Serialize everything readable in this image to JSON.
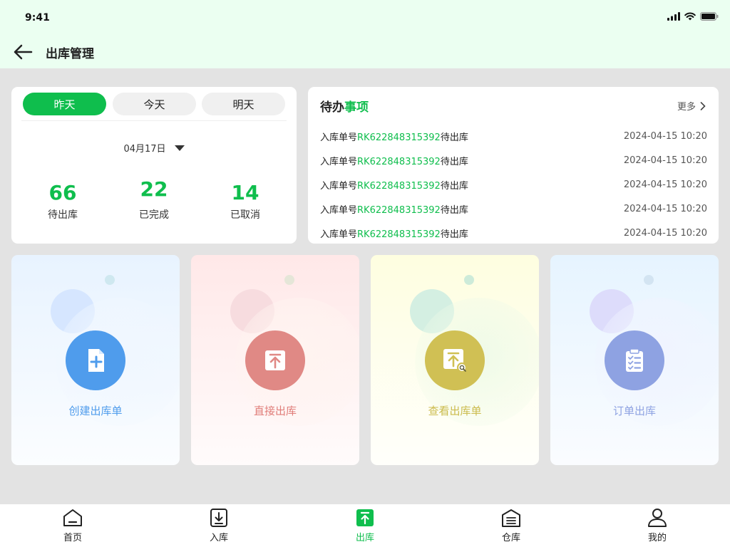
{
  "status_bar": {
    "time": "9:41"
  },
  "header": {
    "title": "出库管理"
  },
  "stats": {
    "tabs": [
      "昨天",
      "今天",
      "明天"
    ],
    "active_tab": 0,
    "date": "04月17日",
    "items": [
      {
        "value": "66",
        "label": "待出库"
      },
      {
        "value": "22",
        "label": "已完成"
      },
      {
        "value": "14",
        "label": "已取消"
      }
    ]
  },
  "todo": {
    "title_prefix": "待办",
    "title_highlight": "事项",
    "more": "更多",
    "items": [
      {
        "prefix": "入库单号",
        "number": "RK622848315392",
        "suffix": "待出库",
        "date": "2024-04-15",
        "time": "10:20"
      },
      {
        "prefix": "入库单号",
        "number": "RK622848315392",
        "suffix": "待出库",
        "date": "2024-04-15",
        "time": "10:20"
      },
      {
        "prefix": "入库单号",
        "number": "RK622848315392",
        "suffix": "待出库",
        "date": "2024-04-15",
        "time": "10:20"
      },
      {
        "prefix": "入库单号",
        "number": "RK622848315392",
        "suffix": "待出库",
        "date": "2024-04-15",
        "time": "10:20"
      },
      {
        "prefix": "入库单号",
        "number": "RK622848315392",
        "suffix": "待出库",
        "date": "2024-04-15",
        "time": "10:20"
      }
    ]
  },
  "actions": [
    {
      "label": "创建出库单",
      "icon": "add-document-icon",
      "color": "#4f9cec",
      "bg": "#eef6ff"
    },
    {
      "label": "直接出库",
      "icon": "upload-box-icon",
      "color": "#e08985",
      "bg": "#ffeeee"
    },
    {
      "label": "查看出库单",
      "icon": "search-upload-icon",
      "color": "#d0c054",
      "bg": "#fffde8"
    },
    {
      "label": "订单出库",
      "icon": "clipboard-check-icon",
      "color": "#8ea2e2",
      "bg": "#eef5ff"
    }
  ],
  "tabbar": {
    "items": [
      {
        "label": "首页",
        "icon": "home-icon"
      },
      {
        "label": "入库",
        "icon": "inbound-icon"
      },
      {
        "label": "出库",
        "icon": "outbound-icon"
      },
      {
        "label": "仓库",
        "icon": "warehouse-icon"
      },
      {
        "label": "我的",
        "icon": "user-icon"
      }
    ],
    "active": 2
  },
  "colors": {
    "accent": "#0fbe4d",
    "header_bg": "#ebfff1",
    "page_bg": "#e3e3e3"
  }
}
